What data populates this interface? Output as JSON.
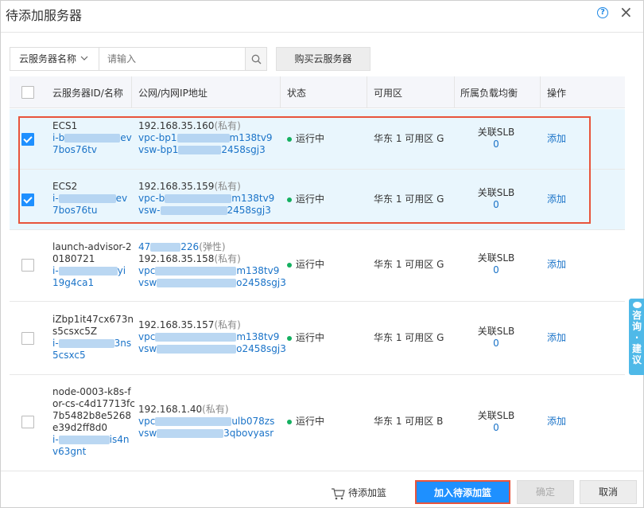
{
  "dialog": {
    "title": "待添加服务器",
    "help_icon": "question-circle-icon",
    "close_icon": "close-icon"
  },
  "search": {
    "type_label": "云服务器名称",
    "placeholder": "请输入",
    "value": "",
    "buy_label": "购买云服务器"
  },
  "table": {
    "columns": [
      "云服务器ID/名称",
      "公网/内网IP地址",
      "状态",
      "可用区",
      "所属负载均衡",
      "操作"
    ],
    "rows": [
      {
        "checked": true,
        "name": "ECS1",
        "id_line1_prefix": "i-b",
        "id_line1_suffix": "ev",
        "id_line2": "7bos76tv",
        "ip_lines": [
          {
            "text": "192.168.35.160",
            "tag": "(私有)"
          }
        ],
        "vpc": {
          "prefix": "vpc-bp1",
          "suffix": "m138tv9"
        },
        "vsw": {
          "prefix": "vsw-bp1",
          "suffix": "2458sgj3"
        },
        "status": "运行中",
        "zone": "华东 1 可用区 G",
        "slb_label": "关联SLB",
        "slb_count": "0",
        "action": "添加"
      },
      {
        "checked": true,
        "name": "ECS2",
        "id_line1_prefix": "i-",
        "id_line1_suffix": "ev",
        "id_line2": "7bos76tu",
        "ip_lines": [
          {
            "text": "192.168.35.159",
            "tag": "(私有)"
          }
        ],
        "vpc": {
          "prefix": "vpc-b",
          "suffix": "m138tv9"
        },
        "vsw": {
          "prefix": "vsw-",
          "suffix": "2458sgj3"
        },
        "status": "运行中",
        "zone": "华东 1 可用区 G",
        "slb_label": "关联SLB",
        "slb_count": "0",
        "action": "添加"
      },
      {
        "checked": false,
        "name_lines": [
          "launch-advisor-2",
          "0180721"
        ],
        "id_line1_prefix": "i-",
        "id_line1_suffix": "yi",
        "id_line2": "19g4ca1",
        "public_ip": {
          "prefix": "47",
          "suffix": "226",
          "tag": "(弹性)"
        },
        "ip_lines": [
          {
            "text": "192.168.35.158",
            "tag": "(私有)"
          }
        ],
        "vpc": {
          "prefix": "vpc",
          "suffix": "m138tv9"
        },
        "vsw": {
          "prefix": "vsw",
          "suffix": "o2458sgj3"
        },
        "status": "运行中",
        "zone": "华东 1 可用区 G",
        "slb_label": "关联SLB",
        "slb_count": "0",
        "action": "添加"
      },
      {
        "checked": false,
        "name_lines": [
          "iZbp1it47cx673n",
          "s5csxc5Z"
        ],
        "id_line1_prefix": "i-",
        "id_line1_suffix": "3ns",
        "id_line2": "5csxc5",
        "ip_lines": [
          {
            "text": "192.168.35.157",
            "tag": "(私有)"
          }
        ],
        "vpc": {
          "prefix": "vpc",
          "suffix": "m138tv9"
        },
        "vsw": {
          "prefix": "vsw",
          "suffix": "o2458sgj3"
        },
        "status": "运行中",
        "zone": "华东 1 可用区 G",
        "slb_label": "关联SLB",
        "slb_count": "0",
        "action": "添加"
      },
      {
        "checked": false,
        "name_lines": [
          "node-0003-k8s-f",
          "or-cs-c4d17713fc",
          "7b5482b8e5268",
          "e39d2ff8d0"
        ],
        "id_line1_prefix": "i-",
        "id_line1_suffix": "is4n",
        "id_line2": "v63gnt",
        "ip_lines": [
          {
            "text": "192.168.1.40",
            "tag": "(私有)"
          }
        ],
        "vpc": {
          "prefix": "vpc",
          "suffix": "ulb078zs"
        },
        "vsw": {
          "prefix": "vsw",
          "suffix": "3qbovyasr"
        },
        "status": "运行中",
        "zone": "华东 1 可用区 B",
        "slb_label": "关联SLB",
        "slb_count": "0",
        "action": "添加"
      }
    ]
  },
  "side_tab": {
    "chars": [
      "咨",
      "询",
      "·",
      "建",
      "议"
    ]
  },
  "footer": {
    "cart_label": "待添加篮",
    "add_label": "加入待添加篮",
    "ok_label": "确定",
    "cancel_label": "取消"
  },
  "colors": {
    "primary": "#1e90ff",
    "link": "#1a73c8",
    "selected_row_bg": "#e9f6fd",
    "highlight_border": "#e8543c",
    "status_running": "#14b060",
    "side_tab": "#4fb9e8"
  }
}
